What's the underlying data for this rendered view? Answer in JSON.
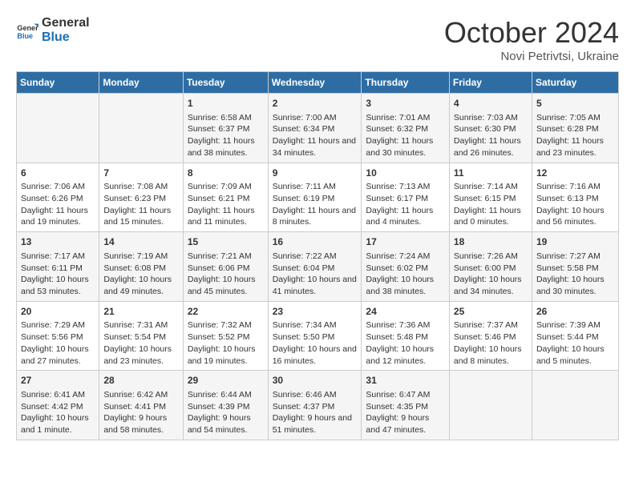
{
  "logo": {
    "text_general": "General",
    "text_blue": "Blue"
  },
  "title": {
    "month_year": "October 2024",
    "location": "Novi Petrivtsi, Ukraine"
  },
  "weekdays": [
    "Sunday",
    "Monday",
    "Tuesday",
    "Wednesday",
    "Thursday",
    "Friday",
    "Saturday"
  ],
  "weeks": [
    [
      {
        "day": "",
        "info": ""
      },
      {
        "day": "",
        "info": ""
      },
      {
        "day": "1",
        "info": "Sunrise: 6:58 AM\nSunset: 6:37 PM\nDaylight: 11 hours and 38 minutes."
      },
      {
        "day": "2",
        "info": "Sunrise: 7:00 AM\nSunset: 6:34 PM\nDaylight: 11 hours and 34 minutes."
      },
      {
        "day": "3",
        "info": "Sunrise: 7:01 AM\nSunset: 6:32 PM\nDaylight: 11 hours and 30 minutes."
      },
      {
        "day": "4",
        "info": "Sunrise: 7:03 AM\nSunset: 6:30 PM\nDaylight: 11 hours and 26 minutes."
      },
      {
        "day": "5",
        "info": "Sunrise: 7:05 AM\nSunset: 6:28 PM\nDaylight: 11 hours and 23 minutes."
      }
    ],
    [
      {
        "day": "6",
        "info": "Sunrise: 7:06 AM\nSunset: 6:26 PM\nDaylight: 11 hours and 19 minutes."
      },
      {
        "day": "7",
        "info": "Sunrise: 7:08 AM\nSunset: 6:23 PM\nDaylight: 11 hours and 15 minutes."
      },
      {
        "day": "8",
        "info": "Sunrise: 7:09 AM\nSunset: 6:21 PM\nDaylight: 11 hours and 11 minutes."
      },
      {
        "day": "9",
        "info": "Sunrise: 7:11 AM\nSunset: 6:19 PM\nDaylight: 11 hours and 8 minutes."
      },
      {
        "day": "10",
        "info": "Sunrise: 7:13 AM\nSunset: 6:17 PM\nDaylight: 11 hours and 4 minutes."
      },
      {
        "day": "11",
        "info": "Sunrise: 7:14 AM\nSunset: 6:15 PM\nDaylight: 11 hours and 0 minutes."
      },
      {
        "day": "12",
        "info": "Sunrise: 7:16 AM\nSunset: 6:13 PM\nDaylight: 10 hours and 56 minutes."
      }
    ],
    [
      {
        "day": "13",
        "info": "Sunrise: 7:17 AM\nSunset: 6:11 PM\nDaylight: 10 hours and 53 minutes."
      },
      {
        "day": "14",
        "info": "Sunrise: 7:19 AM\nSunset: 6:08 PM\nDaylight: 10 hours and 49 minutes."
      },
      {
        "day": "15",
        "info": "Sunrise: 7:21 AM\nSunset: 6:06 PM\nDaylight: 10 hours and 45 minutes."
      },
      {
        "day": "16",
        "info": "Sunrise: 7:22 AM\nSunset: 6:04 PM\nDaylight: 10 hours and 41 minutes."
      },
      {
        "day": "17",
        "info": "Sunrise: 7:24 AM\nSunset: 6:02 PM\nDaylight: 10 hours and 38 minutes."
      },
      {
        "day": "18",
        "info": "Sunrise: 7:26 AM\nSunset: 6:00 PM\nDaylight: 10 hours and 34 minutes."
      },
      {
        "day": "19",
        "info": "Sunrise: 7:27 AM\nSunset: 5:58 PM\nDaylight: 10 hours and 30 minutes."
      }
    ],
    [
      {
        "day": "20",
        "info": "Sunrise: 7:29 AM\nSunset: 5:56 PM\nDaylight: 10 hours and 27 minutes."
      },
      {
        "day": "21",
        "info": "Sunrise: 7:31 AM\nSunset: 5:54 PM\nDaylight: 10 hours and 23 minutes."
      },
      {
        "day": "22",
        "info": "Sunrise: 7:32 AM\nSunset: 5:52 PM\nDaylight: 10 hours and 19 minutes."
      },
      {
        "day": "23",
        "info": "Sunrise: 7:34 AM\nSunset: 5:50 PM\nDaylight: 10 hours and 16 minutes."
      },
      {
        "day": "24",
        "info": "Sunrise: 7:36 AM\nSunset: 5:48 PM\nDaylight: 10 hours and 12 minutes."
      },
      {
        "day": "25",
        "info": "Sunrise: 7:37 AM\nSunset: 5:46 PM\nDaylight: 10 hours and 8 minutes."
      },
      {
        "day": "26",
        "info": "Sunrise: 7:39 AM\nSunset: 5:44 PM\nDaylight: 10 hours and 5 minutes."
      }
    ],
    [
      {
        "day": "27",
        "info": "Sunrise: 6:41 AM\nSunset: 4:42 PM\nDaylight: 10 hours and 1 minute."
      },
      {
        "day": "28",
        "info": "Sunrise: 6:42 AM\nSunset: 4:41 PM\nDaylight: 9 hours and 58 minutes."
      },
      {
        "day": "29",
        "info": "Sunrise: 6:44 AM\nSunset: 4:39 PM\nDaylight: 9 hours and 54 minutes."
      },
      {
        "day": "30",
        "info": "Sunrise: 6:46 AM\nSunset: 4:37 PM\nDaylight: 9 hours and 51 minutes."
      },
      {
        "day": "31",
        "info": "Sunrise: 6:47 AM\nSunset: 4:35 PM\nDaylight: 9 hours and 47 minutes."
      },
      {
        "day": "",
        "info": ""
      },
      {
        "day": "",
        "info": ""
      }
    ]
  ]
}
